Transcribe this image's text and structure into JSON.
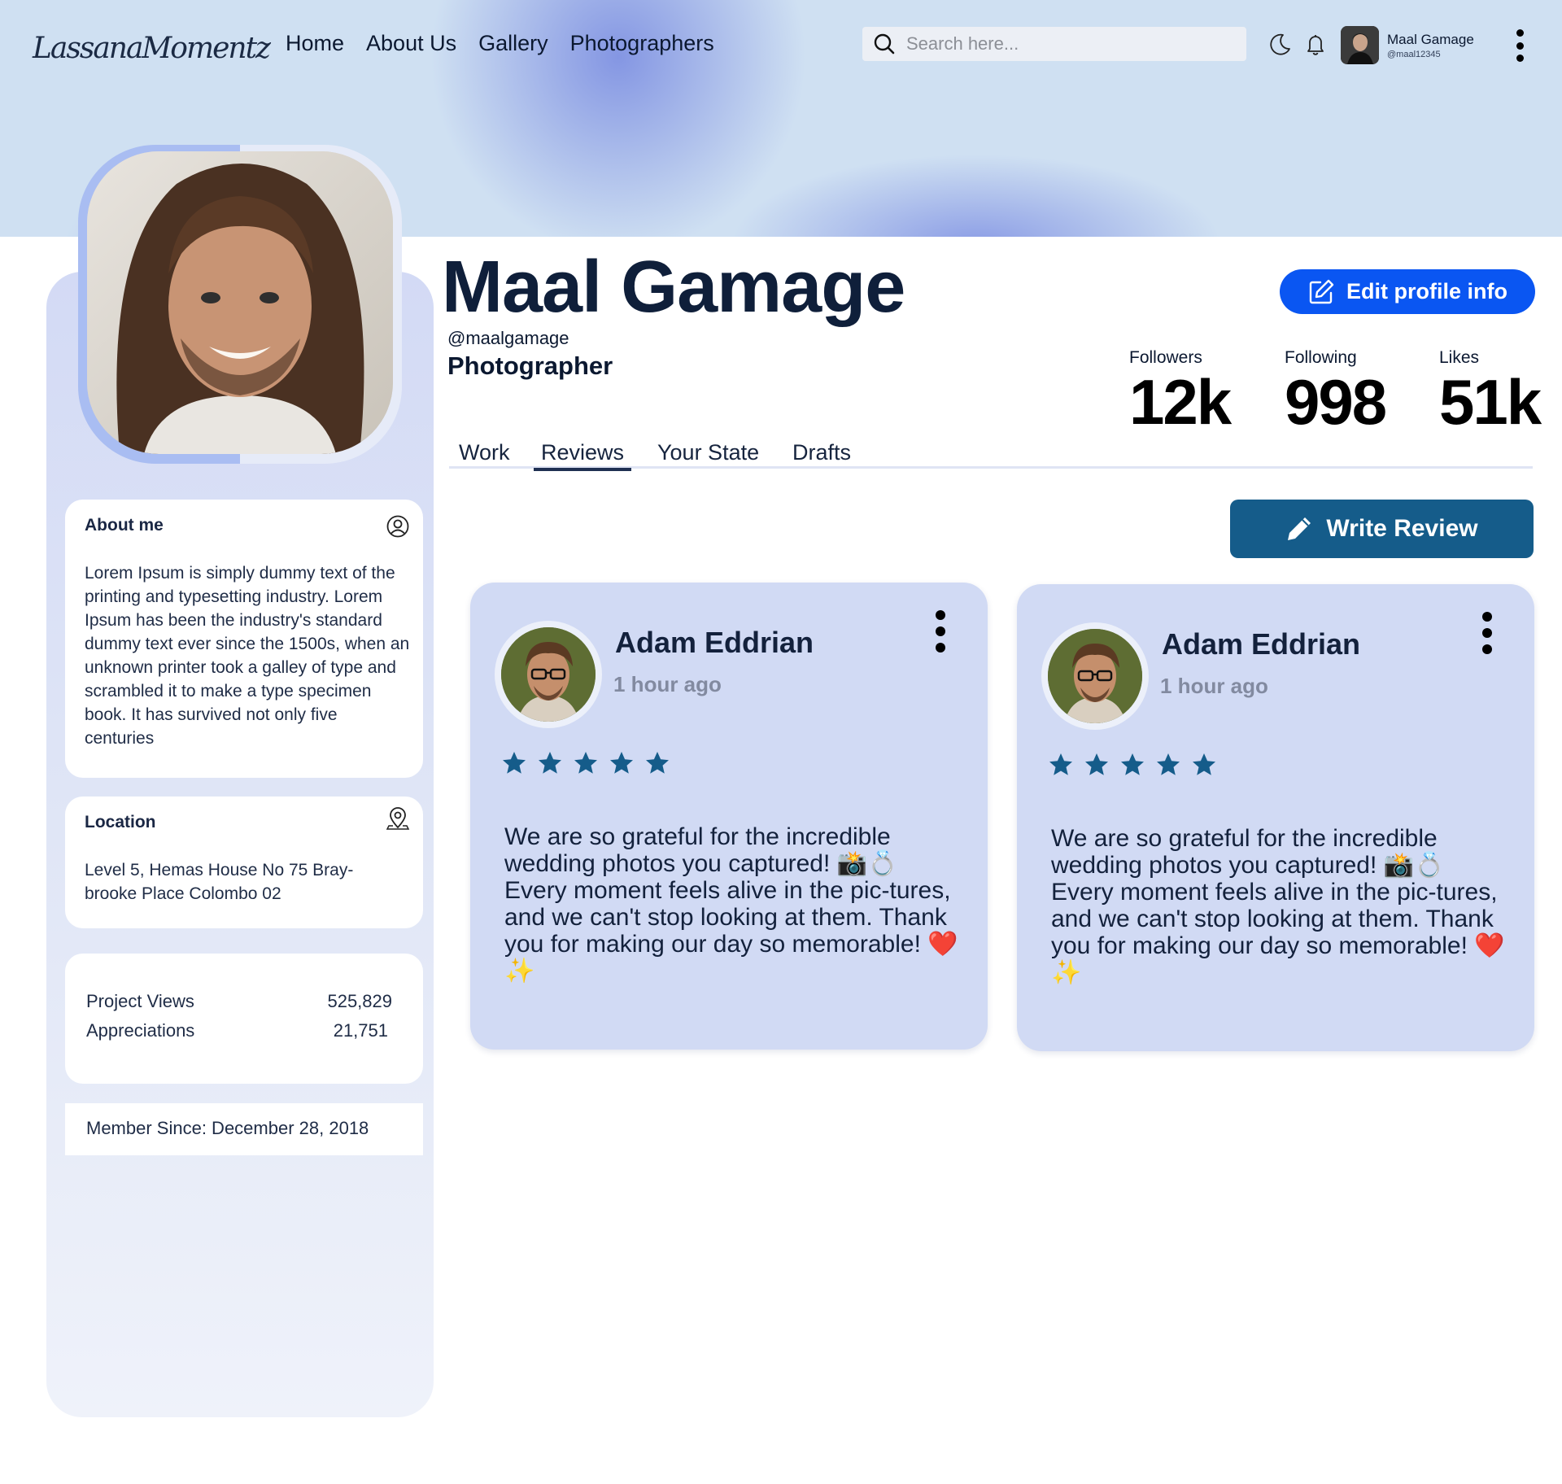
{
  "header": {
    "logo_text": "LassanaMomentz",
    "nav": [
      "Home",
      "About Us",
      "Gallery",
      "Photographers"
    ],
    "search_placeholder": "Search here...",
    "user_name": "Maal Gamage",
    "user_handle": "@maal12345"
  },
  "profile": {
    "name": "Maal Gamage",
    "handle": "@maalgamage",
    "role": "Photographer",
    "edit_label": "Edit profile info",
    "stats": [
      {
        "label": "Followers",
        "value": "12k"
      },
      {
        "label": "Following",
        "value": "998"
      },
      {
        "label": "Likes",
        "value": "51k"
      }
    ]
  },
  "tabs": {
    "items": [
      "Work",
      "Reviews",
      "Your State",
      "Drafts"
    ],
    "active": "Reviews"
  },
  "sidebar": {
    "about_title": "About me",
    "about_text": "Lorem Ipsum is simply dummy text of the printing and typesetting industry. Lorem Ipsum has been the industry's standard dummy text ever since the 1500s, when an unknown printer took a galley of type and scrambled it to make a type specimen book. It has survived not only five centuries",
    "location_title": "Location",
    "location_text": "Level 5, Hemas House No 75 Bray-brooke Place Colombo 02",
    "metrics": [
      {
        "label": "Project Views",
        "value": "525,829"
      },
      {
        "label": "Appreciations",
        "value": "21,751"
      }
    ],
    "member_since": "Member Since: December 28, 2018"
  },
  "write_review_label": "Write Review",
  "reviews": [
    {
      "name": "Adam Eddrian",
      "time": "1 hour ago",
      "rating": 5,
      "text": "We are so grateful for the incredible wedding photos you captured! 📸💍 Every moment feels alive in the pic-tures, and we can't stop looking at them. Thank you for making our day so memorable! ❤️✨"
    },
    {
      "name": "Adam Eddrian",
      "time": "1 hour ago",
      "rating": 5,
      "text": "We are so grateful for the incredible wedding photos you captured! 📸💍 Every moment feels alive in the pic-tures, and we can't stop looking at them. Thank you for making our day so memorable! ❤️✨"
    }
  ],
  "colors": {
    "primary_blue": "#0a56f2",
    "review_button": "#155c8a",
    "star": "#155c8a",
    "review_card": "#d1daf4",
    "heading": "#0f1f3a"
  },
  "icons": {
    "search": "search-icon",
    "theme": "moon-icon",
    "notifications": "bell-icon",
    "menu": "kebab-menu-icon",
    "about": "user-circle-icon",
    "location": "map-pin-icon",
    "edit": "edit-square-icon",
    "write": "pencil-icon",
    "rating": "star-icon"
  }
}
